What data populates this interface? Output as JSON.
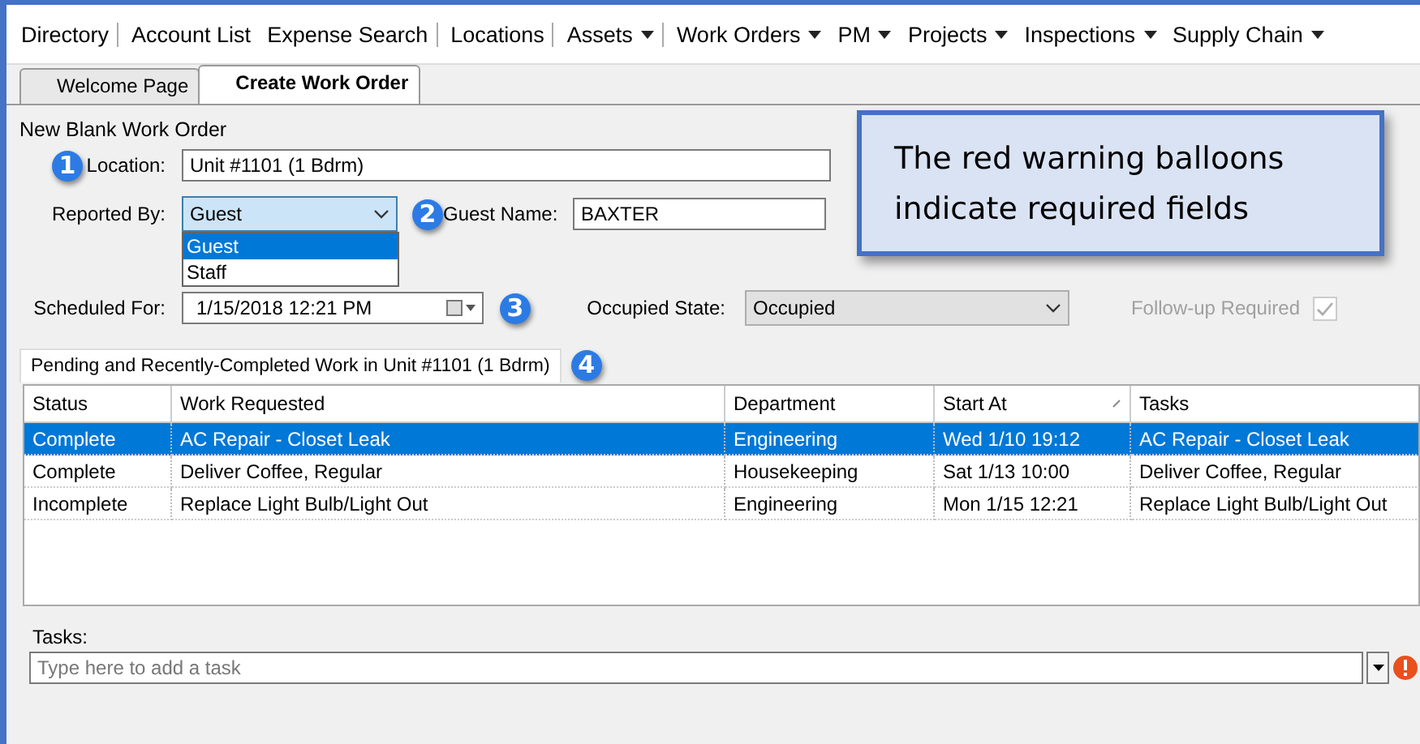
{
  "menu": [
    {
      "label": "Directory",
      "dropdown": false,
      "divider_after": true
    },
    {
      "label": "Account List",
      "dropdown": false,
      "divider_after": false
    },
    {
      "label": "Expense Search",
      "dropdown": false,
      "divider_after": true
    },
    {
      "label": "Locations",
      "dropdown": false,
      "divider_after": true
    },
    {
      "label": "Assets",
      "dropdown": true,
      "divider_after": true
    },
    {
      "label": "Work Orders",
      "dropdown": true,
      "divider_after": false
    },
    {
      "label": "PM",
      "dropdown": true,
      "divider_after": false
    },
    {
      "label": "Projects",
      "dropdown": true,
      "divider_after": false
    },
    {
      "label": "Inspections",
      "dropdown": true,
      "divider_after": false
    },
    {
      "label": "Supply Chain",
      "dropdown": true,
      "divider_after": false
    }
  ],
  "tabs": [
    {
      "label": "Welcome Page",
      "selected": false
    },
    {
      "label": "Create Work Order",
      "selected": true
    }
  ],
  "form_title": "New Blank Work Order",
  "location": {
    "callout": "1",
    "label": "Location:",
    "value": "Unit #1101 (1 Bdrm)"
  },
  "reported_by": {
    "label": "Reported By:",
    "value": "Guest",
    "open": true,
    "options": [
      {
        "label": "Guest",
        "selected": true
      },
      {
        "label": "Staff",
        "selected": false
      }
    ]
  },
  "guest_name": {
    "callout": "2",
    "label": "Guest Name:",
    "value": "BAXTER"
  },
  "scheduled_for": {
    "label": "Scheduled For:",
    "value": "1/15/2018 12:21 PM",
    "callout": "3"
  },
  "occupied_state": {
    "label": "Occupied State:",
    "value": "Occupied"
  },
  "follow_up": {
    "label": "Follow-up Required",
    "checked": true,
    "disabled": true
  },
  "work_tab": {
    "label": "Pending and Recently-Completed Work in Unit #1101 (1 Bdrm)",
    "callout": "4"
  },
  "table": {
    "columns": [
      {
        "label": "Status",
        "sorted": false
      },
      {
        "label": "Work Requested",
        "sorted": false
      },
      {
        "label": "Department",
        "sorted": false
      },
      {
        "label": "Start At",
        "sorted": true
      },
      {
        "label": "Tasks",
        "sorted": false
      }
    ],
    "rows": [
      {
        "cells": [
          "Complete",
          "AC Repair - Closet Leak",
          "Engineering",
          "Wed 1/10 19:12",
          "AC Repair - Closet Leak"
        ],
        "selected": true
      },
      {
        "cells": [
          "Complete",
          "Deliver Coffee, Regular",
          "Housekeeping",
          "Sat 1/13 10:00",
          "Deliver Coffee, Regular"
        ],
        "selected": false
      },
      {
        "cells": [
          "Incomplete",
          "Replace Light Bulb/Light Out",
          "Engineering",
          "Mon 1/15 12:21",
          "Replace Light Bulb/Light Out"
        ],
        "selected": false
      }
    ]
  },
  "tasks": {
    "label": "Tasks:",
    "placeholder": "Type here to add a task",
    "required": true
  },
  "note": "The red warning balloons indicate required fields"
}
